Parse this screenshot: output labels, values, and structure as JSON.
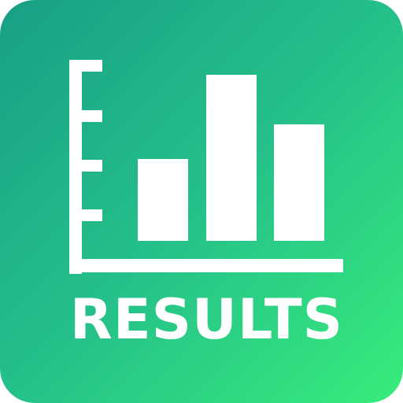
{
  "icon": {
    "name": "results-chart-icon",
    "label": "RESULTS",
    "colors": {
      "gradient_start": "#189f86",
      "gradient_mid": "#25c08a",
      "gradient_end": "#37ec7b",
      "glyph": "#ffffff"
    }
  }
}
